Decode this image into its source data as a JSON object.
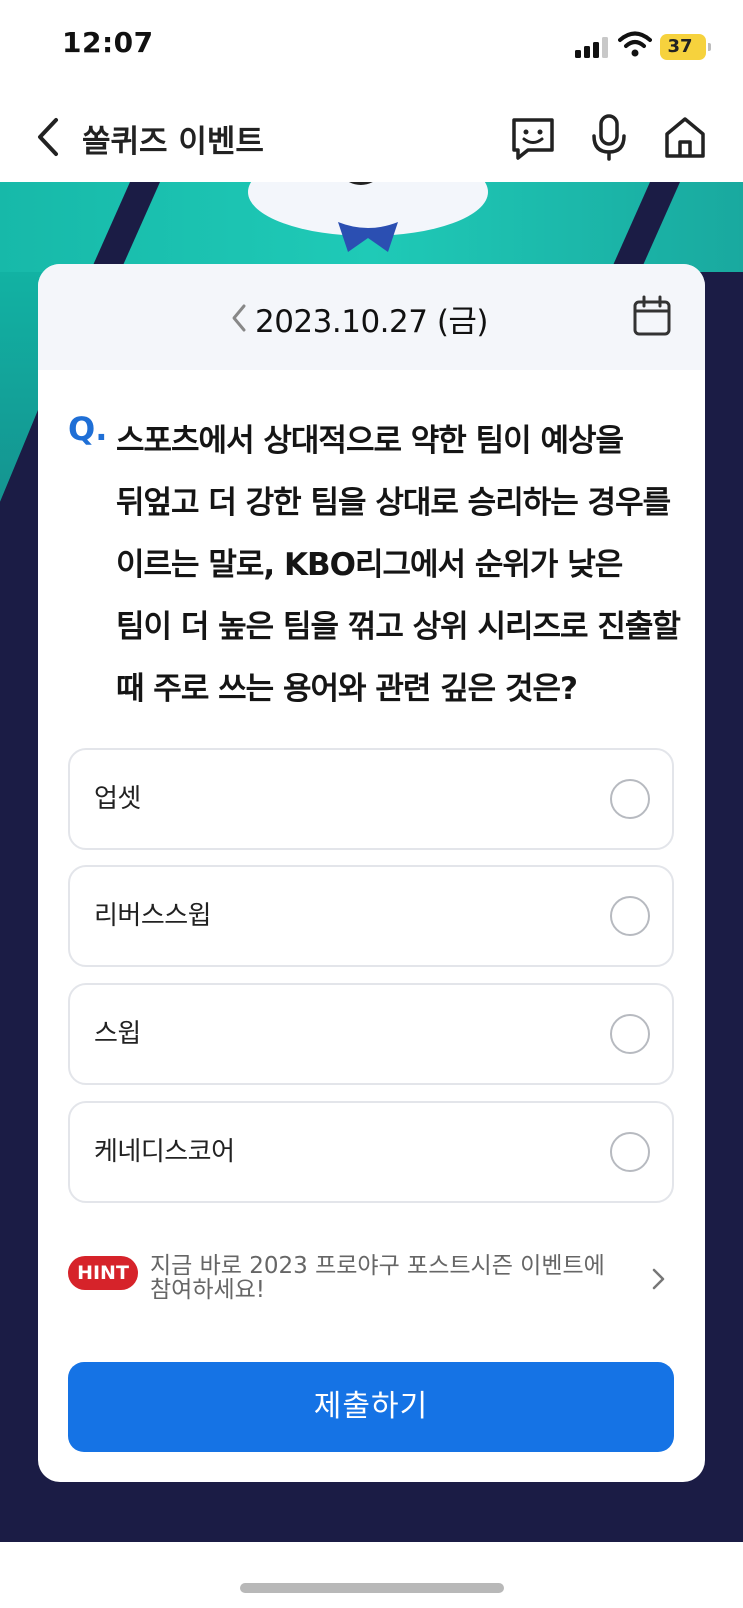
{
  "status_bar": {
    "time": "12:07",
    "battery": "37"
  },
  "header": {
    "title": "쏠퀴즈 이벤트",
    "icons": [
      "chevron-left-icon",
      "chatbot-icon",
      "microphone-icon",
      "home-icon"
    ]
  },
  "quiz": {
    "date": "2023.10.27 (금)",
    "question_mark": "Q.",
    "question": "스포츠에서 상대적으로 약한 팀이 예상을 뒤엎고 더 강한 팀을 상대로 승리하는 경우를 이르는 말로, KBO리그에서 순위가 낮은 팀이 더 높은 팀을 꺾고 상위 시리즈로 진출할 때 주로 쓰는 용어와 관련 깊은 것은?",
    "options": [
      {
        "label": "업셋"
      },
      {
        "label": "리버스스윕"
      },
      {
        "label": "스윕"
      },
      {
        "label": "케네디스코어"
      }
    ],
    "hint_badge": "HINT",
    "hint_text": "지금 바로 2023 프로야구 포스트시즌 이벤트에 참여하세요!",
    "submit_label": "제출하기"
  },
  "colors": {
    "accent": "#1573e5",
    "hint_badge": "#d6232a",
    "banner_teal": "#1fc9b6",
    "banner_navy": "#1b1c45",
    "battery": "#f6d23d"
  }
}
